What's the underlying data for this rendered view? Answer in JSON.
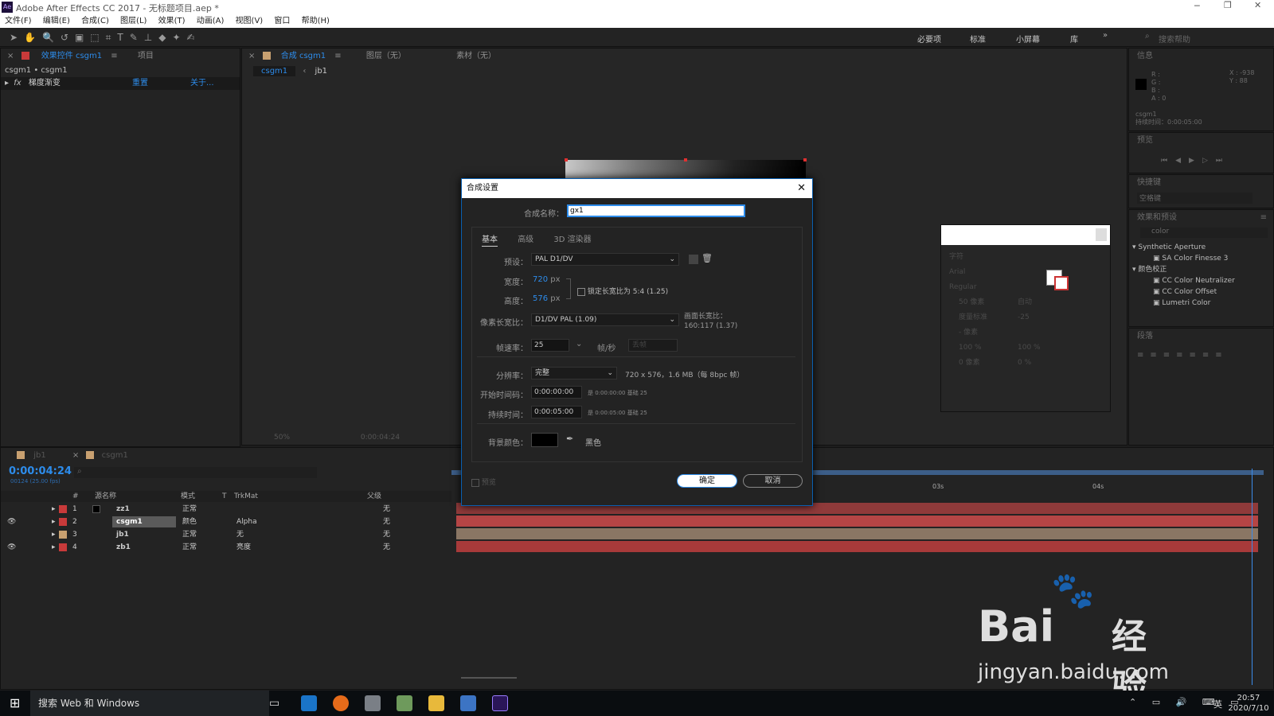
{
  "app": {
    "title": "Adobe After Effects CC 2017 - 无标题项目.aep *",
    "icon": "Ae"
  },
  "menu": [
    "文件(F)",
    "编辑(E)",
    "合成(C)",
    "图层(L)",
    "效果(T)",
    "动画(A)",
    "视图(V)",
    "窗口",
    "帮助(H)"
  ],
  "workspaces": [
    "必要项",
    "标准",
    "小屏幕",
    "库"
  ],
  "search_help": "搜索帮助",
  "effects_panel": {
    "tab": "效果控件 csgm1",
    "tab_project": "项目",
    "path": "csgm1 • csgm1",
    "effect": "梯度渐变",
    "reset": "重置",
    "about": "关于..."
  },
  "comp_panel": {
    "tab": "合成 csgm1",
    "tab_layer": "图层（无）",
    "tab_footage": "素材（无）",
    "crumb1": "csgm1",
    "crumb2": "jb1",
    "zoom": "50%",
    "time": "0:00:04:24"
  },
  "info_panel": {
    "title": "信息",
    "r": "R :",
    "g": "G :",
    "b": "B :",
    "a": "A : 0",
    "x": "X : -938",
    "y": "Y : 88",
    "name": "csgm1",
    "duration": "持续时间：0:00:05:00"
  },
  "preview_panel": {
    "title": "预览"
  },
  "shortcut_panel": {
    "title": "快捷键",
    "value": "空格键"
  },
  "effects_presets": {
    "title": "效果和预设",
    "search": "color",
    "groups": [
      {
        "name": "Synthetic Aperture",
        "items": [
          "SA Color Finesse 3"
        ]
      },
      {
        "name": "颜色校正",
        "items": [
          "CC Color Neutralizer",
          "CC Color Offset",
          "Lumetri Color"
        ]
      }
    ]
  },
  "paragraph_panel": {
    "title": "段落"
  },
  "character_panel": {
    "title": "字符",
    "font": "Arial",
    "style": "Regular",
    "size": "50 像素",
    "lead": "自动",
    "kern": "度量标准",
    "track": "-25",
    "stroke": "- 像素",
    "vscale": "100 %",
    "hscale": "100 %",
    "baseline": "0 像素",
    "tsume": "0 %"
  },
  "dialog": {
    "title": "合成设置",
    "name_label": "合成名称：",
    "name_value": "gx1",
    "tabs": [
      "基本",
      "高级",
      "3D 渲染器"
    ],
    "preset_label": "预设：",
    "preset_value": "PAL D1/DV",
    "width_label": "宽度：",
    "width_value": "720",
    "height_label": "高度：",
    "height_value": "576",
    "px": "px",
    "lock_label": "锁定长宽比为 5:4 (1.25)",
    "par_label": "像素长宽比：",
    "par_value": "D1/DV PAL (1.09)",
    "frame_ar_label": "画面长宽比：",
    "frame_ar_value": "160:117 (1.37)",
    "fps_label": "帧速率：",
    "fps_value": "25",
    "fps_unit": "帧/秒",
    "drop_frame": "丢帧",
    "res_label": "分辨率：",
    "res_value": "完整",
    "res_info": "720 x 576，1.6 MB（每 8bpc 帧）",
    "start_label": "开始时间码：",
    "start_value": "0:00:00:00",
    "start_info": "是 0:00:00:00  基础 25",
    "dur_label": "持续时间：",
    "dur_value": "0:00:05:00",
    "dur_info": "是 0:00:05:00  基础 25",
    "bg_label": "背景颜色：",
    "bg_name": "黑色",
    "preview_label": "预览",
    "ok": "确定",
    "cancel": "取消"
  },
  "timeline": {
    "tab1": "jb1",
    "tab2": "csgm1",
    "time": "0:00:04:24",
    "frames": "00124 (25.00 fps)",
    "columns": [
      "#",
      "源名称",
      "模式",
      "T",
      "TrkMat",
      "父级"
    ],
    "layers": [
      {
        "num": "1",
        "name": "zz1",
        "mode": "正常",
        "trk": "",
        "parent": "无",
        "color": "#c83a3a"
      },
      {
        "num": "2",
        "name": "csgm1",
        "mode": "颜色",
        "trk": "Alpha",
        "parent": "无",
        "color": "#c83a3a"
      },
      {
        "num": "3",
        "name": "jb1",
        "mode": "正常",
        "trk": "无",
        "parent": "无",
        "color": "#c8a070"
      },
      {
        "num": "4",
        "name": "zb1",
        "mode": "正常",
        "trk": "亮度",
        "parent": "无",
        "color": "#c83a3a"
      }
    ],
    "ruler": [
      "03s",
      "04s"
    ]
  },
  "taskbar": {
    "search": "搜索 Web 和 Windows",
    "time": "20:57",
    "date": "2020/7/10",
    "ime": "英"
  },
  "watermark": {
    "main": "Bai",
    "cn": "经验",
    "url": "jingyan.baidu.com"
  }
}
